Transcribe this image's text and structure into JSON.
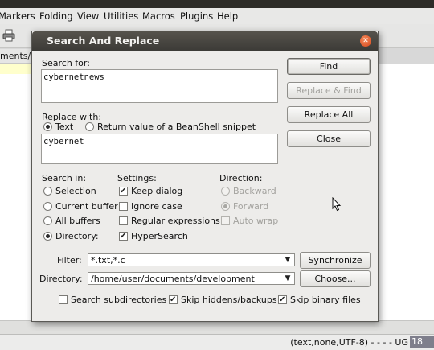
{
  "menubar": {
    "items": [
      "Markers",
      "Folding",
      "View",
      "Utilities",
      "Macros",
      "Plugins",
      "Help"
    ]
  },
  "breadcrumb": "ments/dev",
  "statusbar": {
    "text": "(text,none,UTF-8) - - - - UG",
    "end": "18"
  },
  "dialog": {
    "title": "Search And Replace",
    "search_for": {
      "label": "Search for:",
      "value": "cybernetnews"
    },
    "replace_with": {
      "label": "Replace with:",
      "options": [
        "Text",
        "Return value of a BeanShell snippet"
      ],
      "selected": "Text",
      "value": "cybernet"
    },
    "buttons": {
      "find": "Find",
      "replace_find": "Replace & Find",
      "replace_all": "Replace All",
      "close": "Close",
      "synchronize": "Synchronize",
      "choose": "Choose..."
    },
    "search_in": {
      "label": "Search in:",
      "options": [
        "Selection",
        "Current buffer",
        "All buffers",
        "Directory:"
      ],
      "selected": "Directory:"
    },
    "settings": {
      "label": "Settings:",
      "items": [
        {
          "label": "Keep dialog",
          "checked": true
        },
        {
          "label": "Ignore case",
          "checked": false
        },
        {
          "label": "Regular expressions",
          "checked": false
        },
        {
          "label": "HyperSearch",
          "checked": true
        }
      ]
    },
    "direction": {
      "label": "Direction:",
      "options": [
        "Backward",
        "Forward"
      ],
      "selected": "Forward",
      "auto_wrap": "Auto wrap",
      "disabled": true
    },
    "filter": {
      "label": "Filter:",
      "value": "*.txt,*.c"
    },
    "directory": {
      "label": "Directory:",
      "value": "/home/user/documents/development"
    },
    "options": [
      {
        "label": "Search subdirectories",
        "checked": false
      },
      {
        "label": "Skip hiddens/backups",
        "checked": true
      },
      {
        "label": "Skip binary files",
        "checked": true
      }
    ]
  },
  "icons": [
    "printer-icon",
    "close-icon",
    "dropdown-arrow-icon",
    "mouse-cursor-icon"
  ],
  "colors": {
    "titlebar": "#3c3b37",
    "close": "#d5461a",
    "dialog_bg": "#edecea"
  }
}
